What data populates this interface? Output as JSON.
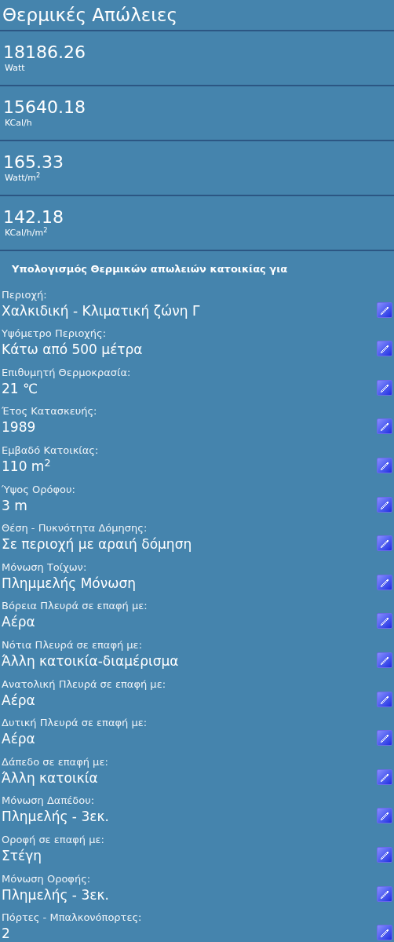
{
  "title": "Θερμικές Απώλειες",
  "results": [
    {
      "value": "18186.26",
      "unit": "Watt"
    },
    {
      "value": "15640.18",
      "unit": "KCal/h"
    },
    {
      "value": "165.33",
      "unit": "Watt/m$^{2}$"
    },
    {
      "value": "142.18",
      "unit": "KCal/h/m$^{2}$"
    }
  ],
  "section_heading": "Υπολογισμός Θερμικών απωλειών κατοικίας για",
  "fields": [
    {
      "label": "Περιοχή:",
      "value": "Χαλκιδική - Κλιματική ζώνη Γ"
    },
    {
      "label": "Υψόμετρο Περιοχής:",
      "value": "Κάτω από 500 μέτρα"
    },
    {
      "label": "Επιθυμητή Θερμοκρασία:",
      "value": "21 ℃"
    },
    {
      "label": "Έτος Κατασκευής:",
      "value": "1989"
    },
    {
      "label": "Εμβαδό Κατοικίας:",
      "value": "110 m$^{2}$"
    },
    {
      "label": "Ύψος Ορόφου:",
      "value": "3 m"
    },
    {
      "label": "Θέση - Πυκνότητα Δόμησης:",
      "value": "Σε περιοχή με αραιή δόμηση"
    },
    {
      "label": "Μόνωση Τοίχων:",
      "value": "Πλημμελής Μόνωση"
    },
    {
      "label": "Βόρεια Πλευρά σε επαφή με:",
      "value": "Αέρα"
    },
    {
      "label": "Νότια Πλευρά σε επαφή με:",
      "value": "Άλλη κατοικία-διαμέρισμα"
    },
    {
      "label": "Ανατολική Πλευρά σε επαφή με:",
      "value": "Αέρα"
    },
    {
      "label": "Δυτική Πλευρά σε επαφή με:",
      "value": "Αέρα"
    },
    {
      "label": "Δάπεδο σε επαφή με:",
      "value": "Άλλη κατοικία"
    },
    {
      "label": "Μόνωση Δαπέδου:",
      "value": "Πλημελής - 3εκ."
    },
    {
      "label": "Οροφή σε επαφή με:",
      "value": "Στέγη"
    },
    {
      "label": "Μόνωση Οροφής:",
      "value": "Πλημελής - 3εκ."
    },
    {
      "label": "Πόρτες - Μπαλκονόπορτες:",
      "value": "2"
    }
  ]
}
